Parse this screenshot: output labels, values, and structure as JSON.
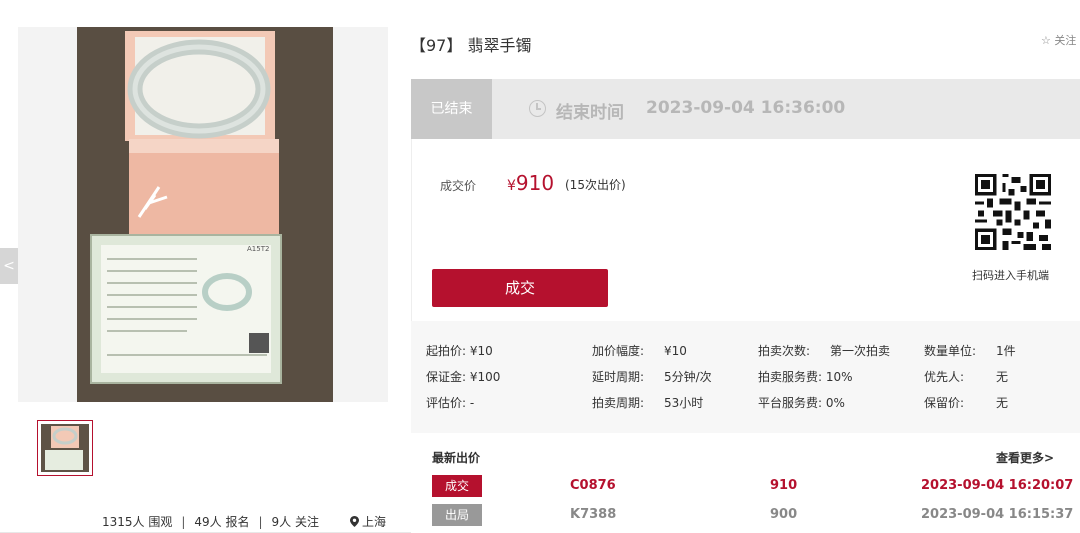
{
  "lot": {
    "title": "【97】 翡翠手镯",
    "follow_label": "☆ 关注"
  },
  "status": {
    "badge": "已结束",
    "end_label": "结束时间",
    "end_time": "2023-09-04 16:36:00"
  },
  "price": {
    "label": "成交价",
    "currency": "¥",
    "value": "910",
    "bid_count": "(15次出价)",
    "deal_button": "成交",
    "qr_caption": "扫码进入手机端"
  },
  "info": {
    "col1": [
      {
        "label": "起拍价:",
        "value": "¥10"
      },
      {
        "label": "保证金:",
        "value": "¥100"
      },
      {
        "label": "评估价:",
        "value": "-"
      }
    ],
    "col2": [
      {
        "label": "加价幅度:",
        "value": "¥10"
      },
      {
        "label": "延时周期:",
        "value": "5分钟/次"
      },
      {
        "label": "拍卖周期:",
        "value": "53小时"
      }
    ],
    "col3": [
      {
        "label": "拍卖次数:",
        "value": "第一次拍卖"
      },
      {
        "label": "拍卖服务费:",
        "value": "10%"
      },
      {
        "label": "平台服务费:",
        "value": "0%"
      }
    ],
    "col4": [
      {
        "label": "数量单位:",
        "value": "1件"
      },
      {
        "label": "优先人:",
        "value": "无"
      },
      {
        "label": "保留价:",
        "value": "无"
      }
    ]
  },
  "latest": {
    "title": "最新出价",
    "see_more": "查看更多>",
    "bids": [
      {
        "tag": "成交",
        "user": "C0876",
        "amount": "910",
        "time": "2023-09-04 16:20:07",
        "color": "#b5112e",
        "tag_bg": "#b5112e"
      },
      {
        "tag": "出局",
        "user": "K7388",
        "amount": "900",
        "time": "2023-09-04 16:15:37",
        "color": "#888888",
        "tag_bg": "#999999"
      }
    ]
  },
  "stats": {
    "views": "1315人 围观",
    "signups": "49人 报名",
    "follows": "9人 关注",
    "sep": "|",
    "location": "上海"
  },
  "gallery": {
    "prev_arrow": "<"
  },
  "colors": {
    "accent": "#b5112e"
  }
}
